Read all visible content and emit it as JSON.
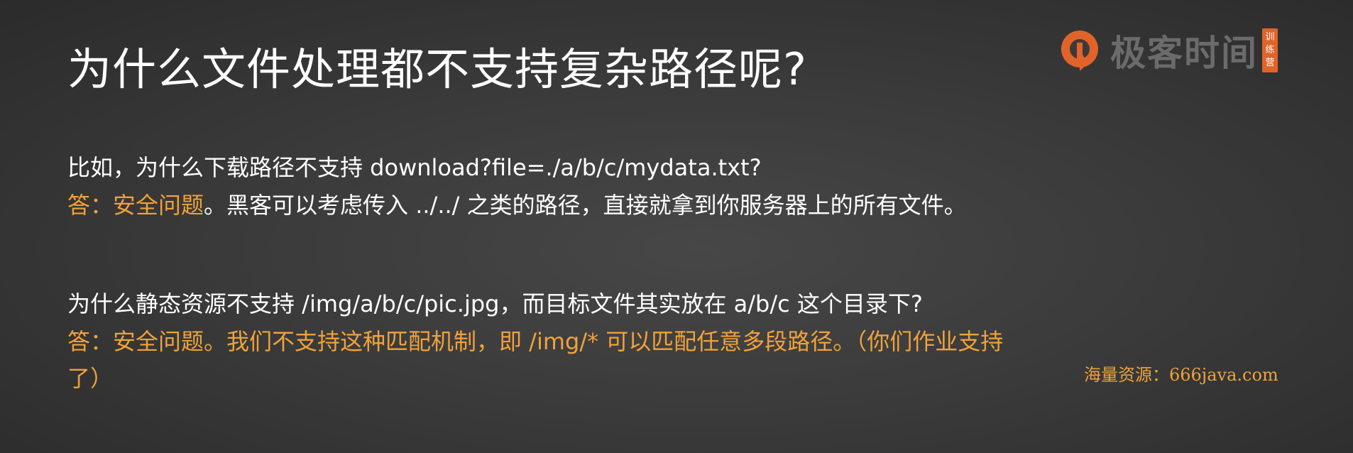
{
  "title": "为什么文件处理都不支持复杂路径呢?",
  "logo": {
    "name": "极客时间",
    "badge": "训练营"
  },
  "q1": "比如，为什么下载路径不支持 download?file=./a/b/c/mydata.txt?",
  "a1_label": "答：安全问题",
  "a1_rest": "。黑客可以考虑传入 ../../ 之类的路径，直接就拿到你服务器上的所有文件。",
  "q2": "为什么静态资源不支持 /img/a/b/c/pic.jpg，而目标文件其实放在 a/b/c 这个目录下?",
  "a2_line1": "答：安全问题。我们不支持这种匹配机制，即 /img/* 可以匹配任意多段路径。（你们作业支持",
  "a2_line2": "了）",
  "watermark": "海量资源：666java.com",
  "colors": {
    "background": "#3b3b3b",
    "answer": "#f0a23a",
    "brand": "#e2632a"
  }
}
